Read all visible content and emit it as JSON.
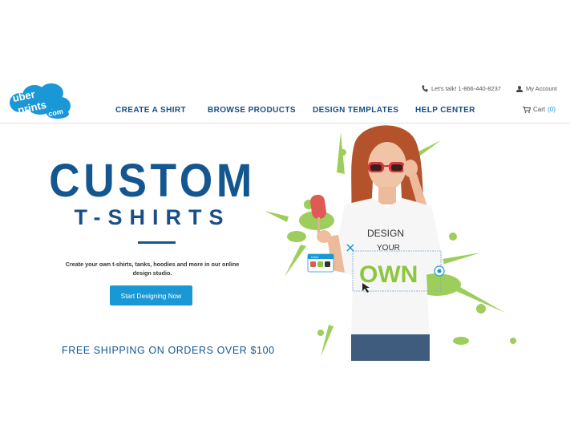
{
  "brand": {
    "logo_line1": "uber",
    "logo_line2": "prints",
    "logo_line3": ".com",
    "color_primary": "#14568f",
    "color_accent": "#1a98d5",
    "color_splash": "#8dc63f"
  },
  "header": {
    "phone_icon": "phone-icon",
    "phone_text": "Let's talk! 1-866-440-8237",
    "account_icon": "user-icon",
    "account_label": "My Account",
    "nav": [
      {
        "label": "CREATE A SHIRT"
      },
      {
        "label": "BROWSE PRODUCTS"
      },
      {
        "label": "DESIGN TEMPLATES"
      },
      {
        "label": "HELP CENTER"
      }
    ],
    "cart_icon": "cart-icon",
    "cart_label": "Cart",
    "cart_count": "(0)"
  },
  "hero": {
    "title_line1": "CUSTOM",
    "title_line2": "T-SHIRTS",
    "subtitle": "Create your own t-shirts, tanks, hoodies and more in our online design studio.",
    "cta_label": "Start Designing Now",
    "shipping_text": "FREE SHIPPING ON ORDERS OVER $100",
    "shirt_text_1": "DESIGN",
    "shirt_text_2": "YOUR",
    "shirt_text_3": "OWN",
    "color_widget_label": "Color"
  }
}
